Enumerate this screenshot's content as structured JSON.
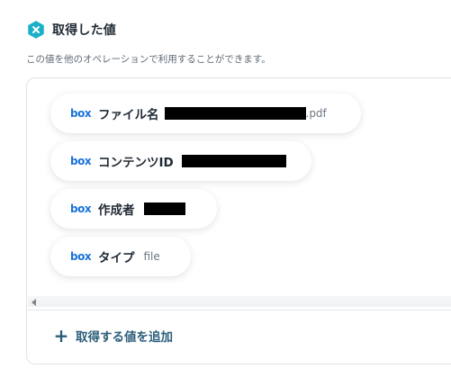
{
  "header": {
    "title": "取得した値",
    "description": "この値を他のオペレーションで利用することができます。"
  },
  "colors": {
    "accent": "#1ab0c8",
    "box_brand": "#1a73d9",
    "add_action": "#2b5d7a"
  },
  "fields": [
    {
      "source_logo": "box",
      "label": "ファイル名",
      "value_redacted": true,
      "suffix": ".pdf"
    },
    {
      "source_logo": "box",
      "label": "コンテンツID",
      "value_redacted": true,
      "suffix": ""
    },
    {
      "source_logo": "box",
      "label": "作成者",
      "value_redacted": true,
      "suffix": ""
    },
    {
      "source_logo": "box",
      "label": "タイプ",
      "value": "file"
    }
  ],
  "actions": {
    "add_value_label": "取得する値を追加"
  },
  "icons": {
    "header_icon": "close-hexagon-icon",
    "add_icon": "plus-icon",
    "scroll_left_icon": "scroll-left-arrow-icon"
  }
}
